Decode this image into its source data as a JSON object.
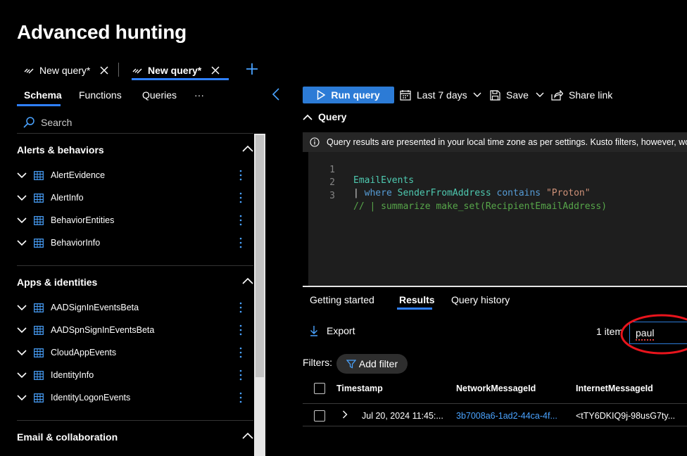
{
  "page_title": "Advanced hunting",
  "query_tabs": [
    {
      "label": "New query*",
      "active": false
    },
    {
      "label": "New query*",
      "active": true
    }
  ],
  "left_tabs": [
    "Schema",
    "Functions",
    "Queries",
    "···"
  ],
  "search_placeholder": "Search",
  "schema_groups": [
    {
      "title": "Alerts & behaviors",
      "items": [
        "AlertEvidence",
        "AlertInfo",
        "BehaviorEntities",
        "BehaviorInfo"
      ]
    },
    {
      "title": "Apps & identities",
      "items": [
        "AADSignInEventsBeta",
        "AADSpnSignInEventsBeta",
        "CloudAppEvents",
        "IdentityInfo",
        "IdentityLogonEvents"
      ]
    },
    {
      "title": "Email & collaboration",
      "items": []
    }
  ],
  "toolbar": {
    "run_label": "Run query",
    "time_range": "Last 7 days",
    "save_label": "Save",
    "share_label": "Share link"
  },
  "query_section_title": "Query",
  "info_text": "Query results are presented in your local time zone as per settings. Kusto filters, however, work in",
  "code": {
    "line_numbers": [
      "1",
      "2",
      "3"
    ],
    "line1": "EmailEvents",
    "line2_pipe": "| ",
    "line2_where": "where",
    "line2_col": "SenderFromAddress",
    "line2_contains": "contains",
    "line2_str": "\"Proton\"",
    "line3": "// | summarize make_set(RecipientEmailAddress)"
  },
  "result_tabs": [
    "Getting started",
    "Results",
    "Query history"
  ],
  "export_label": "Export",
  "items_count": "1 item",
  "filter_value": "paul",
  "filters_label": "Filters:",
  "add_filter_label": "Add filter",
  "columns": [
    "Timestamp",
    "NetworkMessageId",
    "InternetMessageId"
  ],
  "rows": [
    {
      "timestamp": "Jul 20, 2024 11:45:...",
      "network_message_id": "3b7008a6-1ad2-44ca-4f...",
      "internet_message_id": "<tTY6DKIQ9j-98usG7ty..."
    }
  ],
  "colors": {
    "accent": "#2c7bd6",
    "link": "#4aa3ff",
    "annotation": "#e8141c"
  },
  "icons": [
    "query-icon",
    "close-icon",
    "plus-icon",
    "chevron-left-icon",
    "search-icon",
    "chevron-up-icon",
    "chevron-down-icon",
    "table-icon",
    "more-vertical-icon",
    "play-icon",
    "calendar-icon",
    "save-icon",
    "share-icon",
    "info-icon",
    "download-icon",
    "filter-icon",
    "chevron-right-icon"
  ]
}
